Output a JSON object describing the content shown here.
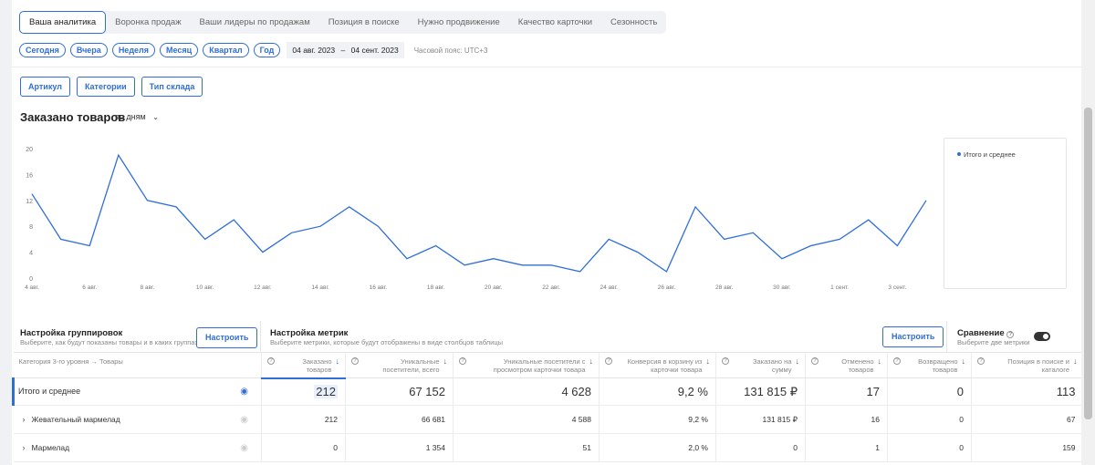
{
  "tabs": [
    "Ваша аналитика",
    "Воронка продаж",
    "Ваши лидеры по продажам",
    "Позиция в поиске",
    "Нужно продвижение",
    "Качество карточки",
    "Сезонность"
  ],
  "periods": [
    "Сегодня",
    "Вчера",
    "Неделя",
    "Месяц",
    "Квартал",
    "Год"
  ],
  "date_from": "04 авг. 2023",
  "date_sep": "–",
  "date_to": "04 сент. 2023",
  "timezone": "Часовой пояс: UTC+3",
  "filters": [
    "Артикул",
    "Категории",
    "Тип склада"
  ],
  "chart_title": "Заказано товаров",
  "chart_mode": "по дням",
  "chart_data": {
    "type": "line",
    "x": [
      "4 авг.",
      "5 авг.",
      "6 авг.",
      "7 авг.",
      "8 авг.",
      "9 авг.",
      "10 авг.",
      "11 авг.",
      "12 авг.",
      "13 авг.",
      "14 авг.",
      "15 авг.",
      "16 авг.",
      "17 авг.",
      "18 авг.",
      "19 авг.",
      "20 авг.",
      "21 авг.",
      "22 авг.",
      "23 авг.",
      "24 авг.",
      "25 авг.",
      "26 авг.",
      "27 авг.",
      "28 авг.",
      "29 авг.",
      "30 авг.",
      "31 авг.",
      "1 сент.",
      "2 сент.",
      "3 сент.",
      "4 сент."
    ],
    "x_tick_labels": [
      "4 авг.",
      "6 авг.",
      "8 авг.",
      "10 авг.",
      "12 авг.",
      "14 авг.",
      "16 авг.",
      "18 авг.",
      "20 авг.",
      "22 авг.",
      "24 авг.",
      "26 авг.",
      "28 авг.",
      "30 авг.",
      "1 сент.",
      "3 сент."
    ],
    "series": [
      {
        "name": "Итого и среднее",
        "color": "#2f6ed9",
        "values": [
          13,
          6,
          5,
          19,
          12,
          11,
          6,
          9,
          4,
          7,
          8,
          11,
          8,
          3,
          5,
          2,
          3,
          2,
          2,
          1,
          6,
          4,
          1,
          11,
          6,
          7,
          3,
          5,
          6,
          9,
          5,
          12
        ]
      }
    ],
    "y_ticks": [
      0,
      4,
      8,
      12,
      16,
      20
    ],
    "ylim": [
      0,
      20
    ],
    "grid": false,
    "legend": "right"
  },
  "grouping": {
    "title": "Настройка группировок",
    "subtitle": "Выберите, как будут показаны товары и в каких группах",
    "button": "Настроить"
  },
  "metrics": {
    "title": "Настройка метрик",
    "subtitle": "Выберите метрики, которые будут отображены в виде столбцов таблицы",
    "button": "Настроить"
  },
  "compare": {
    "title": "Сравнение",
    "subtitle": "Выберите две метрики"
  },
  "table": {
    "first_header": "Категория 3-го уровня → Товары",
    "columns": [
      "Заказано товаров",
      "Уникальные посетители, всего",
      "Уникальные посетители с просмотром карточки товара",
      "Конверсия в корзину из карточки товара",
      "Заказано на сумму",
      "Отменено товаров",
      "Возвращено товаров",
      "Позиция в поиске и каталоге"
    ],
    "total": {
      "name": "Итого и среднее",
      "values": [
        "212",
        "67 152",
        "4 628",
        "9,2 %",
        "131 815 ₽",
        "17",
        "0",
        "113"
      ]
    },
    "rows": [
      {
        "name": "Жевательный мармелад",
        "values": [
          "212",
          "66 681",
          "4 588",
          "9,2 %",
          "131 815 ₽",
          "16",
          "0",
          "67"
        ]
      },
      {
        "name": "Мармелад",
        "values": [
          "0",
          "1 354",
          "51",
          "2,0 %",
          "0",
          "1",
          "0",
          "159"
        ]
      }
    ]
  }
}
